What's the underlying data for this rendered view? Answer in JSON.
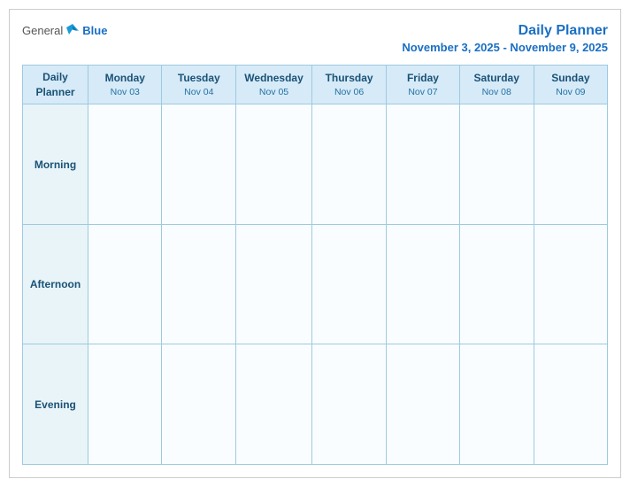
{
  "header": {
    "logo_general": "General",
    "logo_blue": "Blue",
    "title": "Daily Planner",
    "date_range": "November 3, 2025 - November 9, 2025"
  },
  "table": {
    "corner_label_line1": "Daily",
    "corner_label_line2": "Planner",
    "columns": [
      {
        "day": "Monday",
        "date": "Nov 03"
      },
      {
        "day": "Tuesday",
        "date": "Nov 04"
      },
      {
        "day": "Wednesday",
        "date": "Nov 05"
      },
      {
        "day": "Thursday",
        "date": "Nov 06"
      },
      {
        "day": "Friday",
        "date": "Nov 07"
      },
      {
        "day": "Saturday",
        "date": "Nov 08"
      },
      {
        "day": "Sunday",
        "date": "Nov 09"
      }
    ],
    "rows": [
      {
        "label": "Morning"
      },
      {
        "label": "Afternoon"
      },
      {
        "label": "Evening"
      }
    ]
  }
}
